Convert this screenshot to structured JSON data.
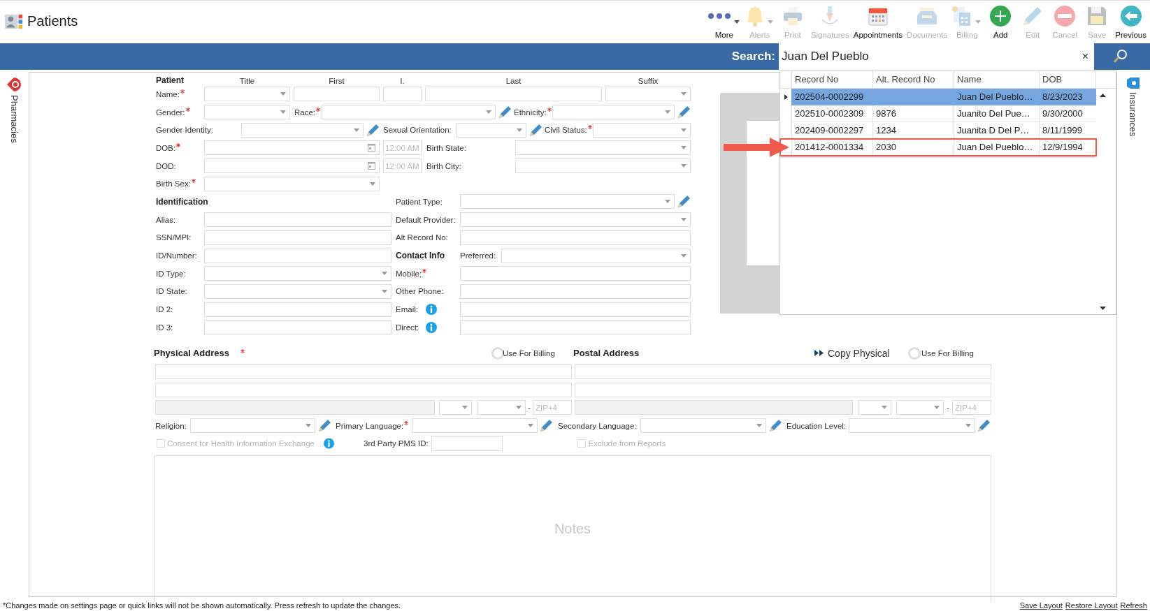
{
  "app": {
    "title": "Patients"
  },
  "toolbar": [
    {
      "label": "More",
      "kind": "more",
      "disabled": false,
      "dropdown": true
    },
    {
      "label": "Alerts",
      "kind": "bell",
      "disabled": true,
      "dropdown": true
    },
    {
      "label": "Print",
      "kind": "printer",
      "disabled": true,
      "dropdown": false
    },
    {
      "label": "Signatures",
      "kind": "pen",
      "disabled": true,
      "dropdown": false
    },
    {
      "label": "Appointments",
      "kind": "calendar",
      "disabled": false,
      "dropdown": false
    },
    {
      "label": "Documents",
      "kind": "tray",
      "disabled": true,
      "dropdown": false
    },
    {
      "label": "Billing",
      "kind": "calculator",
      "disabled": true,
      "dropdown": true
    },
    {
      "label": "Add",
      "kind": "add",
      "disabled": false,
      "dropdown": false
    },
    {
      "label": "Edit",
      "kind": "pencil",
      "disabled": true,
      "dropdown": false
    },
    {
      "label": "Cancel",
      "kind": "cancel",
      "disabled": true,
      "dropdown": false
    },
    {
      "label": "Save",
      "kind": "save",
      "disabled": true,
      "dropdown": false
    },
    {
      "label": "Previous",
      "kind": "back",
      "disabled": false,
      "dropdown": false
    }
  ],
  "search": {
    "label": "Search:",
    "value": "Juan Del Pueblo",
    "clear": "×"
  },
  "side_panels": {
    "left": "Pharmacies",
    "right": "Insurances"
  },
  "results": {
    "columns": [
      "Record No",
      "Alt. Record No",
      "Name",
      "DOB"
    ],
    "rows": [
      {
        "record_no": "202504-0002299",
        "name": "Juan Del Pueblo…",
        "dob": "8/23/2023",
        "selected": true,
        "marked": false
      },
      {
        "record_no": "202510-0002309",
        "alt_record_no": "9876",
        "name": "Juanito Del Pue…",
        "dob": "9/30/2000",
        "selected": false,
        "marked": false
      },
      {
        "record_no": "202409-0002297",
        "alt_record_no": "1234",
        "name": "Juanita D Del P…",
        "dob": "8/11/1999",
        "selected": false,
        "marked": false
      },
      {
        "record_no": "201412-0001334",
        "alt_record_no": "2030",
        "name": "Juan Del Pueblo…",
        "dob": "12/9/1994",
        "selected": false,
        "marked": true
      }
    ]
  },
  "demographics": [
    {
      "items": [
        {
          "kind": "heading",
          "text": "Patient"
        },
        {
          "kind": "colhead",
          "text": "Title"
        },
        {
          "kind": "colhead",
          "text": "First"
        },
        {
          "kind": "colhead",
          "text": "I."
        },
        {
          "kind": "colhead",
          "text": "Last"
        },
        {
          "kind": "colhead",
          "text": "Suffix"
        }
      ]
    },
    {
      "items": [
        {
          "kind": "label",
          "text": "Name:",
          "required": true
        },
        {
          "kind": "select"
        },
        {
          "kind": "input"
        },
        {
          "kind": "input"
        },
        {
          "kind": "input"
        },
        {
          "kind": "select"
        }
      ]
    },
    {
      "items": [
        {
          "kind": "label",
          "text": "Gender:",
          "required": true
        },
        {
          "kind": "select"
        },
        {
          "kind": "label",
          "text": "Race:",
          "required": true
        },
        {
          "kind": "select"
        },
        {
          "kind": "pencil"
        },
        {
          "kind": "label",
          "text": "Ethnicity:",
          "required": true
        },
        {
          "kind": "select"
        },
        {
          "kind": "pencil"
        }
      ]
    },
    {
      "items": [
        {
          "kind": "label",
          "text": "Gender Identity:",
          "required": false
        },
        {
          "kind": "select"
        },
        {
          "kind": "pencil"
        },
        {
          "kind": "label",
          "text": "Sexual Orientation:",
          "required": false
        },
        {
          "kind": "select"
        },
        {
          "kind": "pencil"
        },
        {
          "kind": "label",
          "text": "Civil Status:",
          "required": true
        },
        {
          "kind": "select"
        }
      ]
    },
    {
      "items": [
        {
          "kind": "label",
          "text": "DOB:",
          "required": true
        },
        {
          "kind": "date"
        },
        {
          "kind": "time",
          "placeholder": "12:00 AM"
        },
        {
          "kind": "label",
          "text": "Birth State:",
          "required": false
        },
        {
          "kind": "select"
        }
      ]
    },
    {
      "items": [
        {
          "kind": "label",
          "text": "DOD:",
          "required": false
        },
        {
          "kind": "date"
        },
        {
          "kind": "time",
          "placeholder": "12:00 AM"
        },
        {
          "kind": "label",
          "text": "Birth City:",
          "required": false
        },
        {
          "kind": "select"
        }
      ]
    },
    {
      "items": [
        {
          "kind": "label",
          "text": "Birth Sex:",
          "required": true
        },
        {
          "kind": "select"
        }
      ]
    },
    {
      "items": [
        {
          "kind": "heading",
          "text": "Identification"
        },
        {
          "kind": "label",
          "text": "Patient Type:",
          "required": false
        },
        {
          "kind": "select"
        },
        {
          "kind": "pencil"
        }
      ]
    },
    {
      "items": [
        {
          "kind": "label",
          "text": "Alias:",
          "required": false
        },
        {
          "kind": "input"
        },
        {
          "kind": "label",
          "text": "Default Provider:",
          "required": false
        },
        {
          "kind": "select"
        }
      ]
    },
    {
      "items": [
        {
          "kind": "label",
          "text": "SSN/MPI:",
          "required": false
        },
        {
          "kind": "input"
        },
        {
          "kind": "label",
          "text": "Alt Record No:",
          "required": false
        },
        {
          "kind": "input"
        }
      ]
    },
    {
      "items": [
        {
          "kind": "label",
          "text": "ID/Number:",
          "required": false
        },
        {
          "kind": "input"
        },
        {
          "kind": "heading",
          "text": "Contact Info"
        },
        {
          "kind": "label",
          "text": "Preferred:",
          "required": false
        },
        {
          "kind": "select"
        }
      ]
    },
    {
      "items": [
        {
          "kind": "label",
          "text": "ID Type:",
          "required": false
        },
        {
          "kind": "select"
        },
        {
          "kind": "label",
          "text": "Mobile:",
          "required": true
        },
        {
          "kind": "input"
        }
      ]
    },
    {
      "items": [
        {
          "kind": "label",
          "text": "ID State:",
          "required": false
        },
        {
          "kind": "select"
        },
        {
          "kind": "label",
          "text": "Other Phone:",
          "required": false
        },
        {
          "kind": "input"
        }
      ]
    },
    {
      "items": [
        {
          "kind": "label",
          "text": "ID 2:",
          "required": false
        },
        {
          "kind": "input"
        },
        {
          "kind": "label",
          "text": "Email:",
          "required": false
        },
        {
          "kind": "info"
        },
        {
          "kind": "input"
        }
      ]
    },
    {
      "items": [
        {
          "kind": "label",
          "text": "ID 3:",
          "required": false
        },
        {
          "kind": "input"
        },
        {
          "kind": "label",
          "text": "Direct:",
          "required": false
        },
        {
          "kind": "info"
        },
        {
          "kind": "input"
        }
      ]
    }
  ],
  "address": [
    {
      "items": [
        {
          "kind": "heading",
          "text": "Physical Address",
          "required": true
        },
        {
          "kind": "radio",
          "checked": false
        },
        {
          "kind": "label",
          "text": "Use For Billing",
          "required": false
        },
        {
          "kind": "heading",
          "text": "Postal Address",
          "required": false
        },
        {
          "kind": "link",
          "text": "Copy Physical"
        },
        {
          "kind": "radio",
          "checked": false
        },
        {
          "kind": "label",
          "text": "Use For Billing",
          "required": false
        }
      ]
    },
    {
      "items": [
        {
          "kind": "input"
        },
        {
          "kind": "input"
        }
      ]
    },
    {
      "items": [
        {
          "kind": "input"
        },
        {
          "kind": "input"
        }
      ]
    },
    {
      "items": [
        {
          "kind": "input",
          "disabled": true
        },
        {
          "kind": "select"
        },
        {
          "kind": "select"
        },
        {
          "kind": "text",
          "text": "-"
        },
        {
          "kind": "input",
          "placeholder": "ZIP+4"
        },
        {
          "kind": "input",
          "disabled": true
        },
        {
          "kind": "select"
        },
        {
          "kind": "select"
        },
        {
          "kind": "text",
          "text": "-"
        },
        {
          "kind": "input",
          "placeholder": "ZIP+4"
        }
      ]
    },
    {
      "items": [
        {
          "kind": "label",
          "text": "Religion:",
          "required": false
        },
        {
          "kind": "select"
        },
        {
          "kind": "pencil"
        },
        {
          "kind": "label",
          "text": "Primary Language:",
          "required": true
        },
        {
          "kind": "select"
        },
        {
          "kind": "pencil"
        },
        {
          "kind": "label",
          "text": "Secondary Language:",
          "required": false
        },
        {
          "kind": "select"
        },
        {
          "kind": "pencil"
        },
        {
          "kind": "label",
          "text": "Education Level:",
          "required": false
        },
        {
          "kind": "select"
        },
        {
          "kind": "pencil"
        }
      ]
    },
    {
      "items": [
        {
          "kind": "checkbox",
          "checked": false,
          "disabled": true
        },
        {
          "kind": "label",
          "text": "Consent for Health Information Exchange",
          "required": false,
          "disabled": true
        },
        {
          "kind": "info"
        },
        {
          "kind": "label",
          "text": "3rd Party PMS ID:",
          "required": false
        },
        {
          "kind": "input"
        },
        {
          "kind": "checkbox",
          "checked": false,
          "disabled": true
        },
        {
          "kind": "label",
          "text": "Exclude from Reports",
          "required": false,
          "disabled": true
        }
      ]
    }
  ],
  "notes": {
    "placeholder": "Notes"
  },
  "footer": {
    "note": "*Changes made on settings page or quick links will not be shown automatically. Press refresh to update the changes.",
    "links": [
      "Save Layout",
      "Restore Layout",
      "Refresh"
    ]
  }
}
